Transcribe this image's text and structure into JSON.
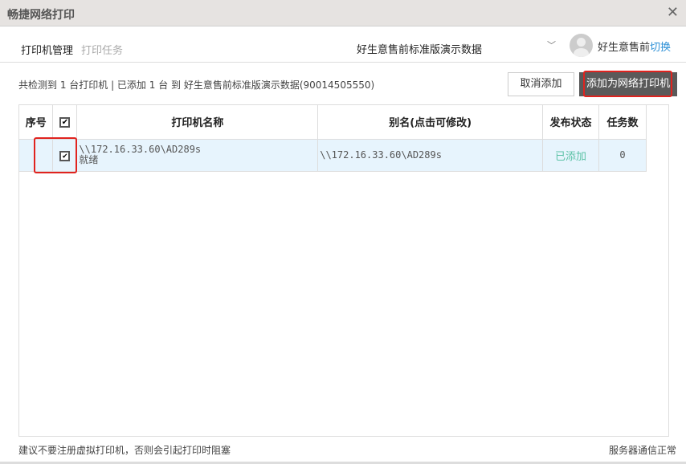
{
  "window": {
    "title": "畅捷网络打印",
    "close_icon": "close-icon"
  },
  "nav": {
    "tabs": [
      {
        "label": "打印机管理",
        "active": true
      },
      {
        "label": "打印任务",
        "active": false
      }
    ],
    "account": "好生意售前标准版演示数据",
    "user": "好生意售前",
    "switch_label": "切换"
  },
  "summary": "共检测到 1 台打印机 | 已添加 1 台 到 好生意售前标准版演示数据(90014505550)",
  "buttons": {
    "cancel_add": "取消添加",
    "add_network": "添加为网络打印机"
  },
  "table": {
    "headers": [
      "序号",
      "",
      "打印机名称",
      "别名(点击可修改)",
      "发布状态",
      "任务数"
    ],
    "header_checked": true,
    "rows": [
      {
        "index": "",
        "checked": true,
        "name": "\\\\172.16.33.60\\AD289s",
        "state": "就绪",
        "alias": "\\\\172.16.33.60\\AD289s",
        "status": "已添加",
        "tasks": "0"
      }
    ]
  },
  "footer": {
    "hint": "建议不要注册虚拟打印机，否则会引起打印时阻塞",
    "server_status": "服务器通信正常"
  },
  "colors": {
    "highlight": "#e0231f",
    "status_added": "#5cc2a6",
    "link": "#2b8fd6",
    "selected_row": "#e7f4fd"
  }
}
